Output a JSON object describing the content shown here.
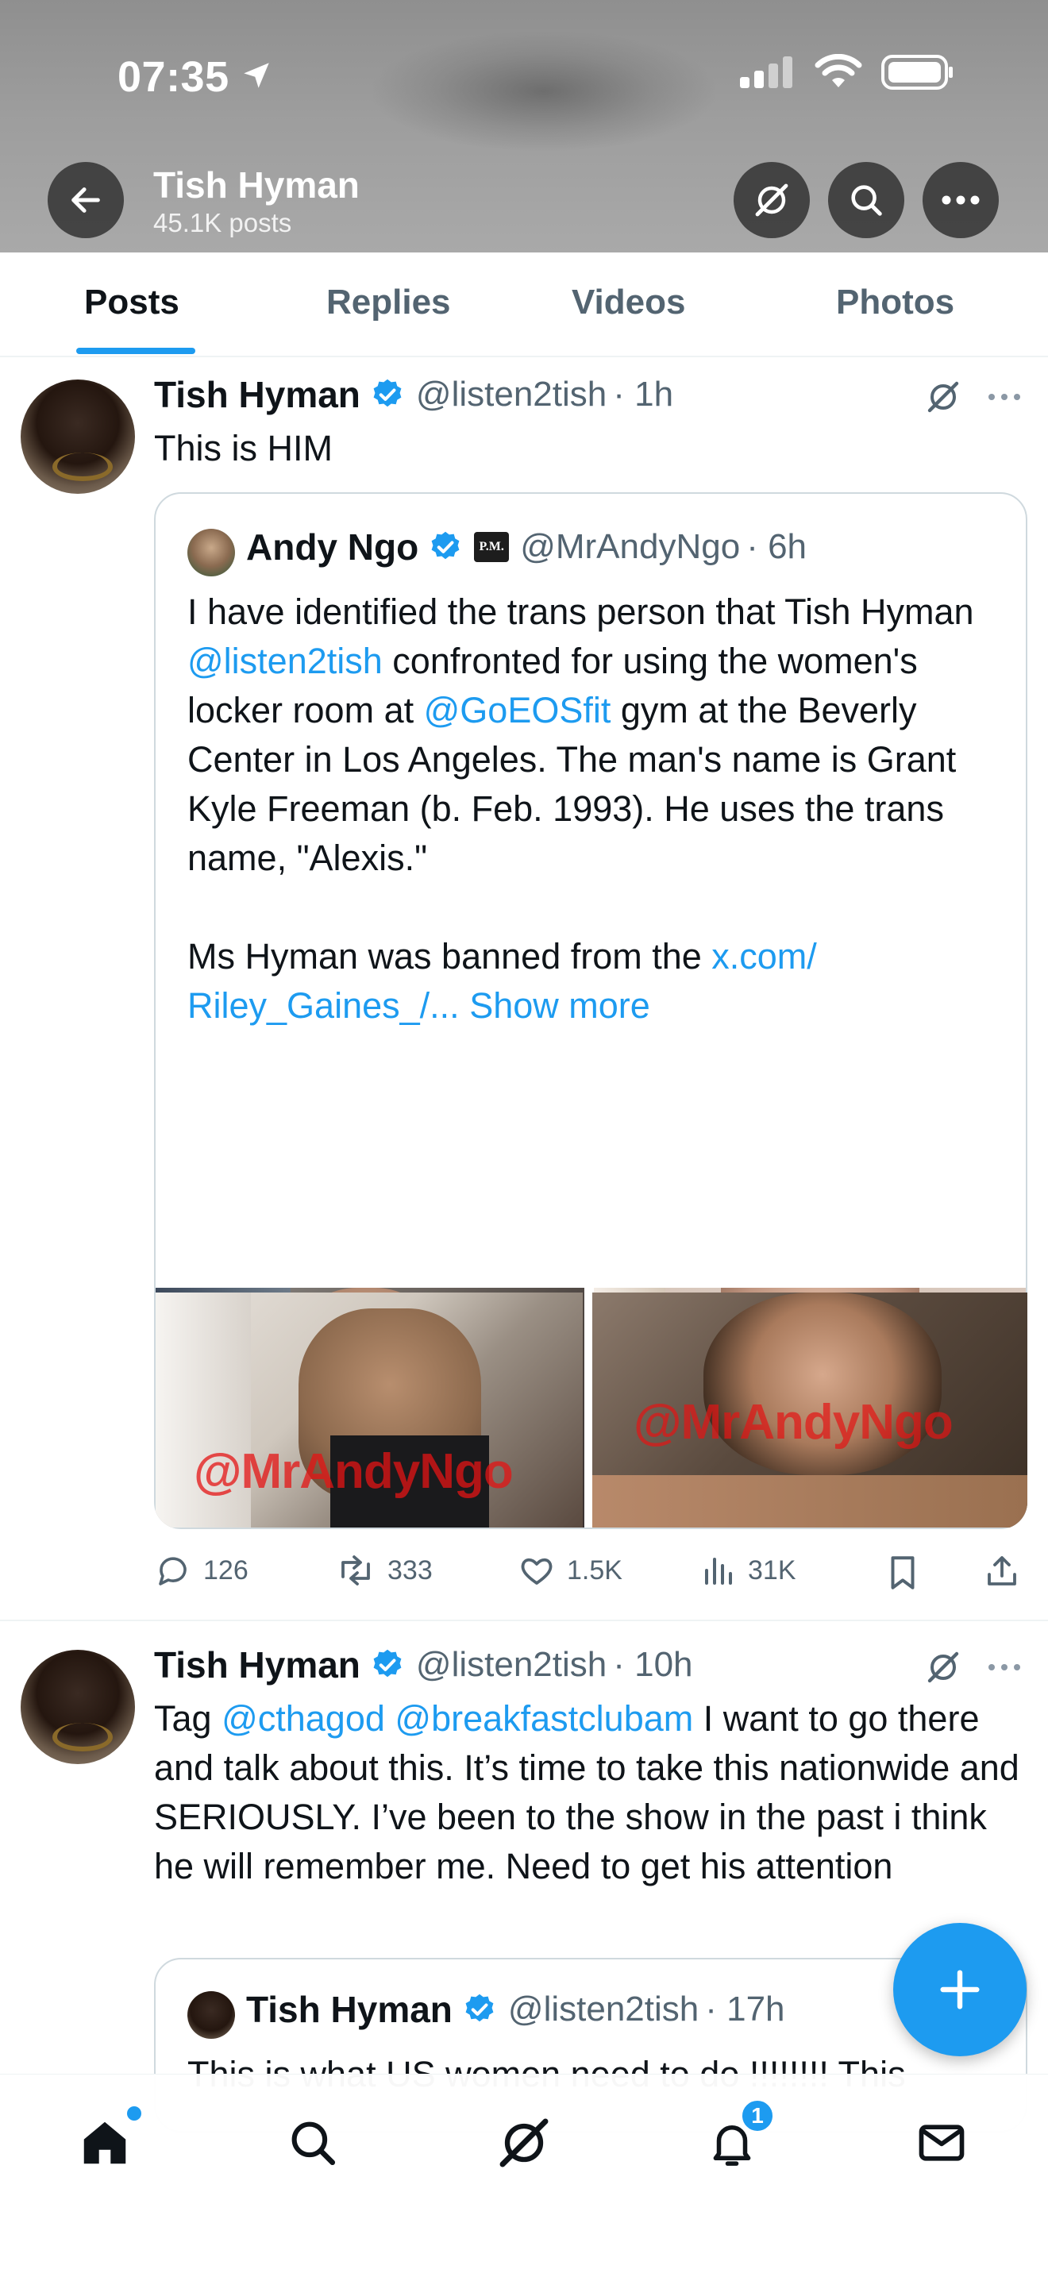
{
  "status_bar": {
    "time": "07:35"
  },
  "header": {
    "name": "Tish Hyman",
    "post_count": "45.1K posts"
  },
  "tabs": [
    {
      "label": "Posts"
    },
    {
      "label": "Replies"
    },
    {
      "label": "Videos"
    },
    {
      "label": "Photos"
    }
  ],
  "posts": [
    {
      "author": "Tish Hyman",
      "handle": "@listen2tish",
      "time": "· 1h",
      "text": "This is HIM",
      "quote": {
        "author": "Andy Ngo",
        "badge": "P.M.",
        "handle": "@MrAndyNgo",
        "time": "· 6h",
        "text_parts": {
          "p1": "I have identified the trans person that Tish Hyman ",
          "link1": "@listen2tish",
          "p2": " confronted for using the women's locker room at ",
          "link2": "@GoEOSfit",
          "p3": " gym at the Beverly Center in Los Angeles. The man's name is Grant Kyle Freeman (b. Feb. 1993). He uses the trans name, \"Alexis.\"",
          "p4": "Ms Hyman was banned from the ",
          "link3": "x.com/ Riley_Gaines_/...",
          "show_more": "Show more"
        },
        "watermark": "@MrAndyNgo"
      },
      "stats": {
        "replies": "126",
        "reposts": "333",
        "likes": "1.5K",
        "views": "31K"
      }
    },
    {
      "author": "Tish Hyman",
      "handle": "@listen2tish",
      "time": "· 10h",
      "text_parts": {
        "p1": "Tag ",
        "link1": "@cthagod",
        "link2": "@breakfastclubam",
        "p2": " I want to go there and talk about this. It’s time to take this nationwide and SERIOUSLY. I’ve been to the show in the past i think he will remember me. Need to get his attention"
      },
      "quote": {
        "author": "Tish Hyman",
        "handle": "@listen2tish",
        "time": "· 17h",
        "text": "This is what US women need to do !!!!!!!! This"
      }
    }
  ],
  "bottom_nav": {
    "notification_count": "1"
  },
  "colors": {
    "accent": "#1d9bf0",
    "text": "#0f1419",
    "muted": "#536471",
    "watermark": "#e41414"
  }
}
